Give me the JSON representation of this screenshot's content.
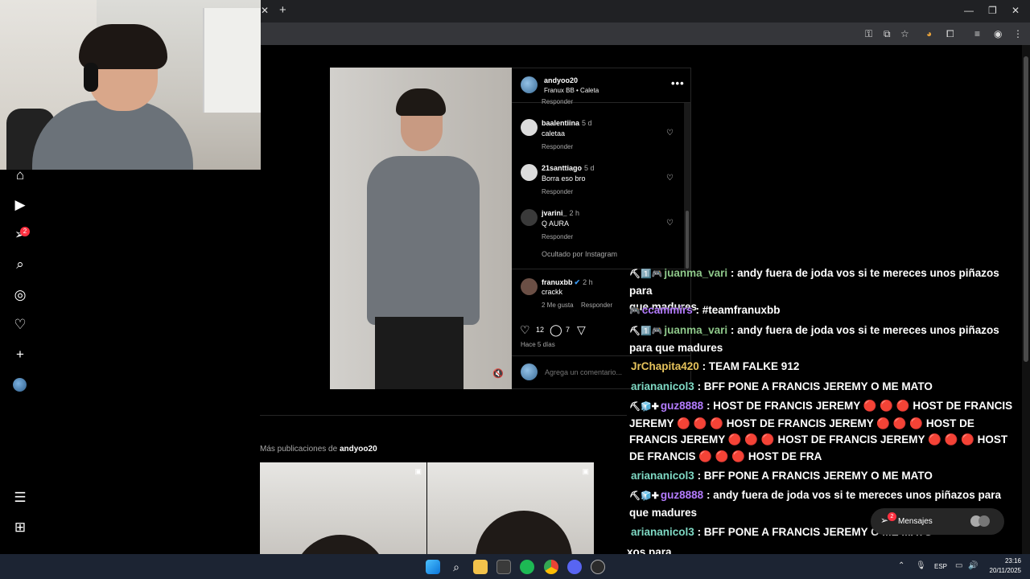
{
  "browser": {
    "tab_close": "✕",
    "tab_new": "+",
    "window_minimize": "—",
    "window_restore": "❐",
    "window_close": "✕"
  },
  "post": {
    "owner": "andyoo20",
    "audio": "Franux BB • Caleta",
    "more": "•••",
    "muted_icon": "🔇",
    "likes": "12",
    "comments_count": "7",
    "date": "Hace 5 días",
    "add_comment_placeholder": "Agrega un comentario..."
  },
  "comments": [
    {
      "user": "baalentiina",
      "time": "5 d",
      "text": "caletaa",
      "reply": "Responder"
    },
    {
      "user": "21santtiago",
      "time": "5 d",
      "text": "Borra eso bro",
      "reply": "Responder"
    },
    {
      "user": "jvarini_",
      "time": "2 h",
      "text": "Q AURA",
      "reply": "Responder"
    }
  ],
  "partial_reply": "Responder",
  "hidden_by": "Ocultado por Instagram",
  "owner_comment": {
    "user": "franuxbb",
    "time": "2 h",
    "text": "crackk",
    "likes": "2 Me gusta",
    "reply": "Responder"
  },
  "more_posts": {
    "prefix": "Más publicaciones de",
    "user": "andyoo20"
  },
  "chat": [
    {
      "badges": "🎮",
      "user": "ccammirs",
      "message": ": #teamfranuxbb",
      "cls": "u-purple"
    },
    {
      "badges": "⛏1️⃣🎮",
      "user": "juanma_vari",
      "message": ": andy fuera de joda vos si te mereces unos piñazos para que madures",
      "cls": "u-green"
    },
    {
      "badges": "",
      "user": "JrChapita420",
      "message": ": TEAM FALKE 912",
      "cls": "u-gold"
    },
    {
      "badges": "",
      "user": "ariananicol3",
      "message": ": BFF PONE A FRANCIS JEREMY O ME MATO",
      "cls": "u-teal"
    },
    {
      "badges": "⛏🧊✚",
      "user": "guz8888",
      "message": ": HOST DE FRANCIS JEREMY 🔴 🔴 🔴 HOST DE FRANCIS JEREMY 🔴 🔴 🔴 HOST DE FRANCIS JEREMY 🔴 🔴 🔴 HOST DE FRANCIS JEREMY 🔴 🔴 🔴 HOST DE FRANCIS JEREMY 🔴 🔴 🔴 HOST DE FRANCIS 🔴 🔴 🔴 HOST DE FRA",
      "cls": "u-purple"
    },
    {
      "badges": "",
      "user": "ariananicol3",
      "message": ": BFF PONE A FRANCIS JEREMY O ME MATO",
      "cls": "u-teal"
    },
    {
      "badges": "⛏🧊✚",
      "user": "guz8888",
      "message": ": andy fuera de joda vos si te mereces unos piñazos para que madures",
      "cls": "u-purple"
    },
    {
      "badges": "",
      "user": "ariananicol3",
      "message": ": BFF PONE A FRANCIS JEREMY O ME MATO",
      "cls": "u-teal"
    }
  ],
  "chat_top_partial": {
    "badges": "⛏1️⃣🎮",
    "user": "juanma_vari",
    "message": ": andy fuera de joda vos si te mereces unos piñazos para",
    "tail": "que madures"
  },
  "chat_bottom_partial": "xos para",
  "messages": {
    "label": "Mensajes",
    "badge": "2"
  },
  "nav": {
    "notif_badge": "2"
  },
  "taskbar": {
    "lang": "ESP",
    "time": "23:16",
    "date": "20/11/2025"
  }
}
